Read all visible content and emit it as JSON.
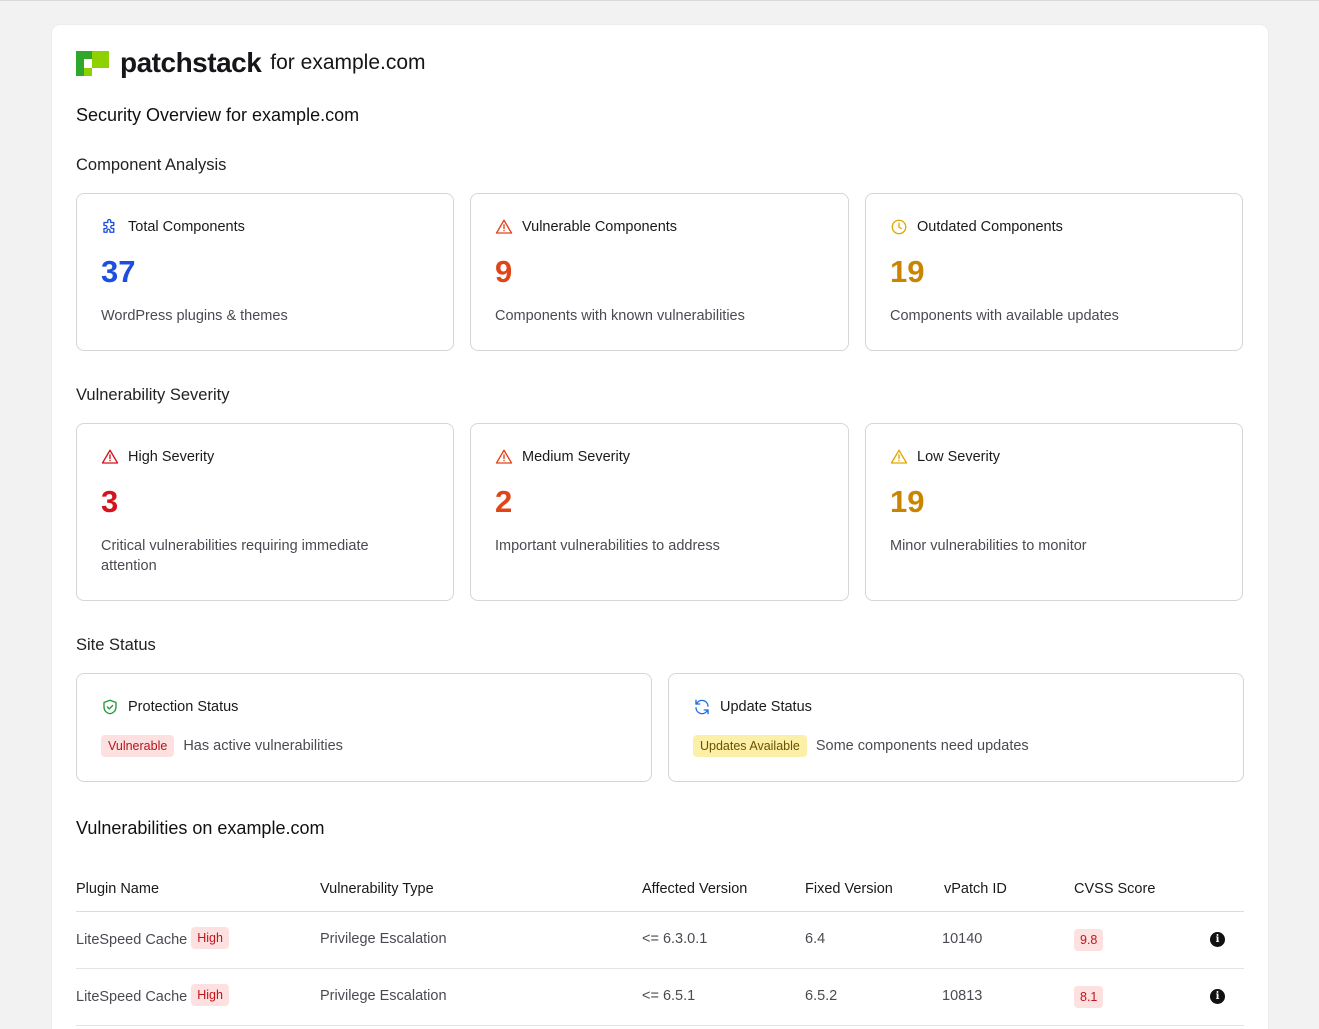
{
  "brand": {
    "wordmark": "patchstack",
    "for_domain": "for example.com",
    "colors": {
      "lime": "#8fd000",
      "green": "#2fa82a",
      "dark": "#16161a"
    }
  },
  "page_title": "Security Overview for example.com",
  "component_analysis": {
    "title": "Component Analysis",
    "cards": [
      {
        "icon": "puzzle-icon",
        "label": "Total Components",
        "value": "37",
        "desc": "WordPress plugins & themes",
        "color": "#1d4ee0"
      },
      {
        "icon": "warning-triangle-icon",
        "label": "Vulnerable Components",
        "value": "9",
        "desc": "Components with known vulnerabilities",
        "color": "#e0451a"
      },
      {
        "icon": "clock-icon",
        "label": "Outdated Components",
        "value": "19",
        "desc": "Components with available updates",
        "color": "#c98400"
      }
    ]
  },
  "vulnerability_severity": {
    "title": "Vulnerability Severity",
    "cards": [
      {
        "icon": "warning-triangle-icon",
        "label": "High Severity",
        "value": "3",
        "desc": "Critical vulnerabilities requiring immediate attention",
        "color": "#d4141c"
      },
      {
        "icon": "warning-triangle-icon",
        "label": "Medium Severity",
        "value": "2",
        "desc": "Important vulnerabilities to address",
        "color": "#e0451a"
      },
      {
        "icon": "warning-triangle-icon",
        "label": "Low Severity",
        "value": "19",
        "desc": "Minor vulnerabilities to monitor",
        "color": "#c98400"
      }
    ]
  },
  "site_status": {
    "title": "Site Status",
    "protection": {
      "icon": "shield-check-icon",
      "label": "Protection Status",
      "badge": "Vulnerable",
      "text": "Has active vulnerabilities"
    },
    "update": {
      "icon": "refresh-icon",
      "label": "Update Status",
      "badge": "Updates Available",
      "text": "Some components need updates"
    }
  },
  "vulnerabilities": {
    "title": "Vulnerabilities on example.com",
    "columns": [
      "Plugin Name",
      "Vulnerability Type",
      "Affected Version",
      "Fixed Version",
      "vPatch ID",
      "CVSS Score"
    ],
    "rows": [
      {
        "plugin": "LiteSpeed Cache",
        "severity": "High",
        "type": "Privilege Escalation",
        "affected": "<= 6.3.0.1",
        "fixed": "6.4",
        "vpatch": "10140",
        "cvss": "9.8",
        "info": "i"
      },
      {
        "plugin": "LiteSpeed Cache",
        "severity": "High",
        "type": "Privilege Escalation",
        "affected": "<= 6.5.1",
        "fixed": "6.5.2",
        "vpatch": "10813",
        "cvss": "8.1",
        "info": "i"
      }
    ]
  }
}
